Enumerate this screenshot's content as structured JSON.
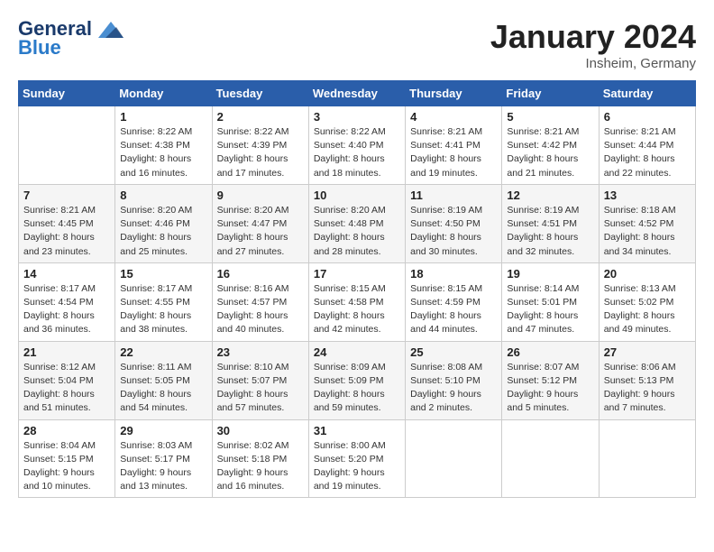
{
  "logo": {
    "line1": "General",
    "line2": "Blue"
  },
  "title": "January 2024",
  "location": "Insheim, Germany",
  "days_header": [
    "Sunday",
    "Monday",
    "Tuesday",
    "Wednesday",
    "Thursday",
    "Friday",
    "Saturday"
  ],
  "weeks": [
    [
      {
        "day": "",
        "sunrise": "",
        "sunset": "",
        "daylight": ""
      },
      {
        "day": "1",
        "sunrise": "Sunrise: 8:22 AM",
        "sunset": "Sunset: 4:38 PM",
        "daylight": "Daylight: 8 hours and 16 minutes."
      },
      {
        "day": "2",
        "sunrise": "Sunrise: 8:22 AM",
        "sunset": "Sunset: 4:39 PM",
        "daylight": "Daylight: 8 hours and 17 minutes."
      },
      {
        "day": "3",
        "sunrise": "Sunrise: 8:22 AM",
        "sunset": "Sunset: 4:40 PM",
        "daylight": "Daylight: 8 hours and 18 minutes."
      },
      {
        "day": "4",
        "sunrise": "Sunrise: 8:21 AM",
        "sunset": "Sunset: 4:41 PM",
        "daylight": "Daylight: 8 hours and 19 minutes."
      },
      {
        "day": "5",
        "sunrise": "Sunrise: 8:21 AM",
        "sunset": "Sunset: 4:42 PM",
        "daylight": "Daylight: 8 hours and 21 minutes."
      },
      {
        "day": "6",
        "sunrise": "Sunrise: 8:21 AM",
        "sunset": "Sunset: 4:44 PM",
        "daylight": "Daylight: 8 hours and 22 minutes."
      }
    ],
    [
      {
        "day": "7",
        "sunrise": "Sunrise: 8:21 AM",
        "sunset": "Sunset: 4:45 PM",
        "daylight": "Daylight: 8 hours and 23 minutes."
      },
      {
        "day": "8",
        "sunrise": "Sunrise: 8:20 AM",
        "sunset": "Sunset: 4:46 PM",
        "daylight": "Daylight: 8 hours and 25 minutes."
      },
      {
        "day": "9",
        "sunrise": "Sunrise: 8:20 AM",
        "sunset": "Sunset: 4:47 PM",
        "daylight": "Daylight: 8 hours and 27 minutes."
      },
      {
        "day": "10",
        "sunrise": "Sunrise: 8:20 AM",
        "sunset": "Sunset: 4:48 PM",
        "daylight": "Daylight: 8 hours and 28 minutes."
      },
      {
        "day": "11",
        "sunrise": "Sunrise: 8:19 AM",
        "sunset": "Sunset: 4:50 PM",
        "daylight": "Daylight: 8 hours and 30 minutes."
      },
      {
        "day": "12",
        "sunrise": "Sunrise: 8:19 AM",
        "sunset": "Sunset: 4:51 PM",
        "daylight": "Daylight: 8 hours and 32 minutes."
      },
      {
        "day": "13",
        "sunrise": "Sunrise: 8:18 AM",
        "sunset": "Sunset: 4:52 PM",
        "daylight": "Daylight: 8 hours and 34 minutes."
      }
    ],
    [
      {
        "day": "14",
        "sunrise": "Sunrise: 8:17 AM",
        "sunset": "Sunset: 4:54 PM",
        "daylight": "Daylight: 8 hours and 36 minutes."
      },
      {
        "day": "15",
        "sunrise": "Sunrise: 8:17 AM",
        "sunset": "Sunset: 4:55 PM",
        "daylight": "Daylight: 8 hours and 38 minutes."
      },
      {
        "day": "16",
        "sunrise": "Sunrise: 8:16 AM",
        "sunset": "Sunset: 4:57 PM",
        "daylight": "Daylight: 8 hours and 40 minutes."
      },
      {
        "day": "17",
        "sunrise": "Sunrise: 8:15 AM",
        "sunset": "Sunset: 4:58 PM",
        "daylight": "Daylight: 8 hours and 42 minutes."
      },
      {
        "day": "18",
        "sunrise": "Sunrise: 8:15 AM",
        "sunset": "Sunset: 4:59 PM",
        "daylight": "Daylight: 8 hours and 44 minutes."
      },
      {
        "day": "19",
        "sunrise": "Sunrise: 8:14 AM",
        "sunset": "Sunset: 5:01 PM",
        "daylight": "Daylight: 8 hours and 47 minutes."
      },
      {
        "day": "20",
        "sunrise": "Sunrise: 8:13 AM",
        "sunset": "Sunset: 5:02 PM",
        "daylight": "Daylight: 8 hours and 49 minutes."
      }
    ],
    [
      {
        "day": "21",
        "sunrise": "Sunrise: 8:12 AM",
        "sunset": "Sunset: 5:04 PM",
        "daylight": "Daylight: 8 hours and 51 minutes."
      },
      {
        "day": "22",
        "sunrise": "Sunrise: 8:11 AM",
        "sunset": "Sunset: 5:05 PM",
        "daylight": "Daylight: 8 hours and 54 minutes."
      },
      {
        "day": "23",
        "sunrise": "Sunrise: 8:10 AM",
        "sunset": "Sunset: 5:07 PM",
        "daylight": "Daylight: 8 hours and 57 minutes."
      },
      {
        "day": "24",
        "sunrise": "Sunrise: 8:09 AM",
        "sunset": "Sunset: 5:09 PM",
        "daylight": "Daylight: 8 hours and 59 minutes."
      },
      {
        "day": "25",
        "sunrise": "Sunrise: 8:08 AM",
        "sunset": "Sunset: 5:10 PM",
        "daylight": "Daylight: 9 hours and 2 minutes."
      },
      {
        "day": "26",
        "sunrise": "Sunrise: 8:07 AM",
        "sunset": "Sunset: 5:12 PM",
        "daylight": "Daylight: 9 hours and 5 minutes."
      },
      {
        "day": "27",
        "sunrise": "Sunrise: 8:06 AM",
        "sunset": "Sunset: 5:13 PM",
        "daylight": "Daylight: 9 hours and 7 minutes."
      }
    ],
    [
      {
        "day": "28",
        "sunrise": "Sunrise: 8:04 AM",
        "sunset": "Sunset: 5:15 PM",
        "daylight": "Daylight: 9 hours and 10 minutes."
      },
      {
        "day": "29",
        "sunrise": "Sunrise: 8:03 AM",
        "sunset": "Sunset: 5:17 PM",
        "daylight": "Daylight: 9 hours and 13 minutes."
      },
      {
        "day": "30",
        "sunrise": "Sunrise: 8:02 AM",
        "sunset": "Sunset: 5:18 PM",
        "daylight": "Daylight: 9 hours and 16 minutes."
      },
      {
        "day": "31",
        "sunrise": "Sunrise: 8:00 AM",
        "sunset": "Sunset: 5:20 PM",
        "daylight": "Daylight: 9 hours and 19 minutes."
      },
      {
        "day": "",
        "sunrise": "",
        "sunset": "",
        "daylight": ""
      },
      {
        "day": "",
        "sunrise": "",
        "sunset": "",
        "daylight": ""
      },
      {
        "day": "",
        "sunrise": "",
        "sunset": "",
        "daylight": ""
      }
    ]
  ]
}
